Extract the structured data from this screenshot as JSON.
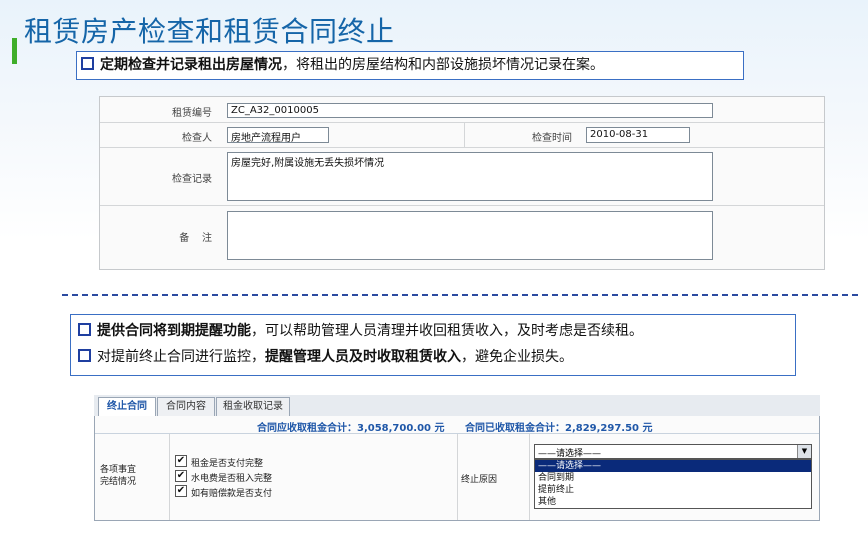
{
  "title": "租赁房产检查和租赁合同终止",
  "callout1": {
    "bold": "定期检查并记录租出房屋情况",
    "rest": "，将租出的房屋结构和内部设施损坏情况记录在案。"
  },
  "form1": {
    "lease_no_label": "租赁编号",
    "lease_no_value": "ZC_A32_0010005",
    "inspector_label": "检查人",
    "inspector_value": "房地产流程用户",
    "time_label": "检查时间",
    "time_value": "2010-08-31",
    "record_label": "检查记录",
    "record_value": "房屋完好,附属设施无丢失损坏情况",
    "remark_label": "备    注",
    "remark_value": ""
  },
  "callout2": {
    "line1_bold": "提供合同将到期提醒功能",
    "line1_rest": "，可以帮助管理人员清理并收回租赁收入，及时考虑是否续租。",
    "line2_pre": "对提前终止合同进行监控，",
    "line2_bold": "提醒管理人员及时收取租赁收入",
    "line2_rest": "，避免企业损失。"
  },
  "form2": {
    "tabs": [
      "终止合同",
      "合同内容",
      "租金收取记录"
    ],
    "summary_due": "合同应收取租金合计：3,058,700.00 元",
    "summary_received": "合同已收取租金合计：2,829,297.50 元",
    "items_label_1": "各项事宜",
    "items_label_2": "完结情况",
    "checks": [
      {
        "label": "租金是否支付完整",
        "checked": "✔"
      },
      {
        "label": "水电费是否租入完整",
        "checked": "✔"
      },
      {
        "label": "如有赔偿款是否支付",
        "checked": "✔"
      }
    ],
    "reason_label": "终止原因",
    "select_value": "——请选择——",
    "options": [
      "——请选择——",
      "合同到期",
      "提前终止",
      "其他"
    ]
  }
}
